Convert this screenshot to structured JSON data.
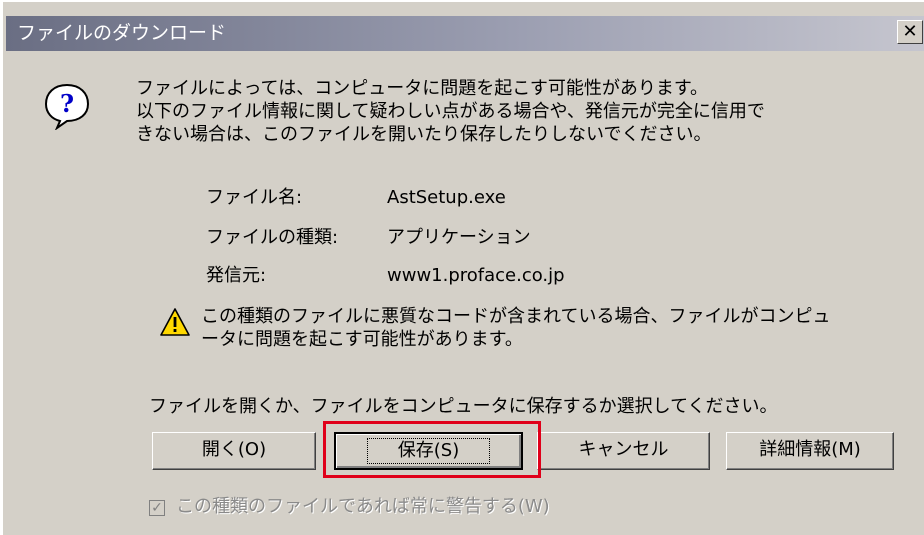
{
  "dialog": {
    "title": "ファイルのダウンロード",
    "close_glyph": "✕",
    "message_lines": [
      "ファイルによっては、コンピュータに問題を起こす可能性があります。",
      "以下のファイル情報に関して疑わしい点がある場合や、発信元が完全に信用で",
      "きない場合は、このファイルを開いたり保存したりしないでください。"
    ],
    "info": {
      "filename_label": "ファイル名:",
      "filename_value": "AstSetup.exe",
      "type_label": "ファイルの種類:",
      "type_value": "アプリケーション",
      "source_label": "発信元:",
      "source_value": "www1.proface.co.jp"
    },
    "warning_lines": [
      "この種類のファイルに悪質なコードが含まれている場合、ファイルがコンピュ",
      "ータに問題を起こす可能性があります。"
    ],
    "prompt": "ファイルを開くか、ファイルをコンピュータに保存するか選択してください。",
    "buttons": {
      "open": "開く(O)",
      "save": "保存(S)",
      "cancel": "キャンセル",
      "details": "詳細情報(M)"
    },
    "checkbox_label": "この種類のファイルであれば常に警告する(W)",
    "checkbox_checked": true,
    "checkbox_glyph": "✓"
  },
  "icons": {
    "question": "question-icon",
    "warning": "warning-icon",
    "close": "close-icon"
  },
  "colors": {
    "dialog_face": "#d4d0c8",
    "highlight_box": "#e0001a"
  }
}
